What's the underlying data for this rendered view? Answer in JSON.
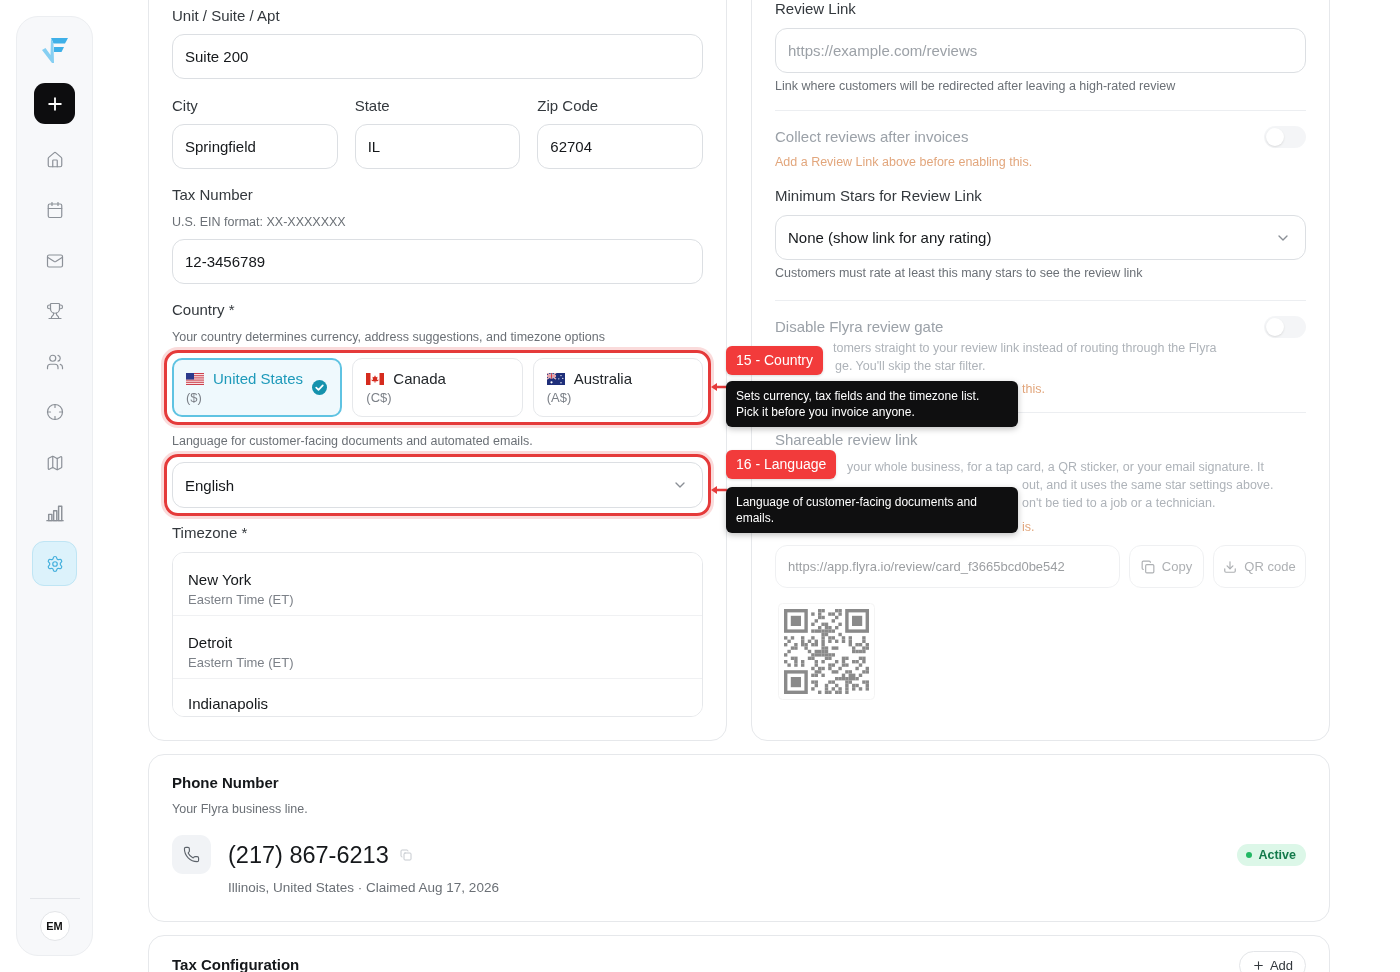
{
  "sidebar": {
    "items": [
      {
        "selected": false
      },
      {
        "selected": false
      },
      {
        "selected": false
      },
      {
        "selected": false
      },
      {
        "selected": false
      },
      {
        "selected": false
      },
      {
        "selected": false
      },
      {
        "selected": false
      },
      {
        "selected": true
      }
    ],
    "avatar": "EM"
  },
  "address": {
    "unit": {
      "label": "Unit / Suite / Apt",
      "value": "Suite 200"
    },
    "city": {
      "label": "City",
      "value": "Springfield"
    },
    "state": {
      "label": "State",
      "value": "IL"
    },
    "zip": {
      "label": "Zip Code",
      "value": "62704"
    }
  },
  "tax_number": {
    "label": "Tax Number",
    "hint": "U.S. EIN format: XX-XXXXXXX",
    "value": "12-3456789"
  },
  "country": {
    "label": "Country *",
    "hint": "Your country determines currency, address suggestions, and timezone options",
    "options": [
      {
        "name": "United States",
        "currency": "($)",
        "selected": true
      },
      {
        "name": "Canada",
        "currency": "(C$)",
        "selected": false
      },
      {
        "name": "Australia",
        "currency": "(A$)",
        "selected": false
      }
    ]
  },
  "language": {
    "hint": "Language for customer-facing documents and automated emails.",
    "value": "English"
  },
  "timezone": {
    "label": "Timezone *",
    "options": [
      {
        "city": "New York",
        "zone": "Eastern Time (ET)",
        "selected": false
      },
      {
        "city": "Detroit",
        "zone": "Eastern Time (ET)",
        "selected": false
      },
      {
        "city": "Indianapolis",
        "selected": false
      }
    ]
  },
  "annotations": [
    {
      "label": "15 - Country",
      "text": "Sets currency, tax fields and the timezone list. Pick it before you invoice anyone."
    },
    {
      "label": "16 - Language",
      "text": "Language of customer-facing documents and emails."
    }
  ],
  "review_settings": {
    "review_link": {
      "label": "Review Link",
      "placeholder": "https://example.com/reviews",
      "help": "Link where customers will be redirected after leaving a high-rated review"
    },
    "collect_reviews": {
      "title": "Collect reviews after invoices",
      "on": false,
      "disabled": true,
      "warning": "Add a Review Link above before enabling this."
    },
    "minimum_stars": {
      "label": "Minimum Stars for Review Link",
      "value": "None (show link for any rating)",
      "help": "Customers must rate at least this many stars to see the review link"
    },
    "review_gate": {
      "title": "Disable Flyra review gate",
      "on": false,
      "disabled": true,
      "description_lines": [
        "tomers straight to your review link instead of routing through the Flyra",
        "ge. You'll skip the star filter."
      ],
      "warning": "this."
    },
    "shareable_link": {
      "title": "Shareable review link",
      "disabled": true,
      "description_lines": [
        "your whole business, for a tap card, a QR sticker, or your email signature. It",
        "out, and it uses the same star settings above.",
        "on't be tied to a job or a technician."
      ],
      "warning": "is.",
      "url": "https://app.flyra.io/review/card_f3665bcd0be542",
      "copy_button": "Copy",
      "qr_button": "QR code"
    }
  },
  "phone_card": {
    "title": "Phone Number",
    "subtitle": "Your Flyra business line.",
    "number": "(217) 867-6213",
    "details": "Illinois, United States · Claimed Aug 17, 2026",
    "status": "Active"
  },
  "tax_configuration": {
    "title": "Tax Configuration",
    "button": "Add"
  }
}
